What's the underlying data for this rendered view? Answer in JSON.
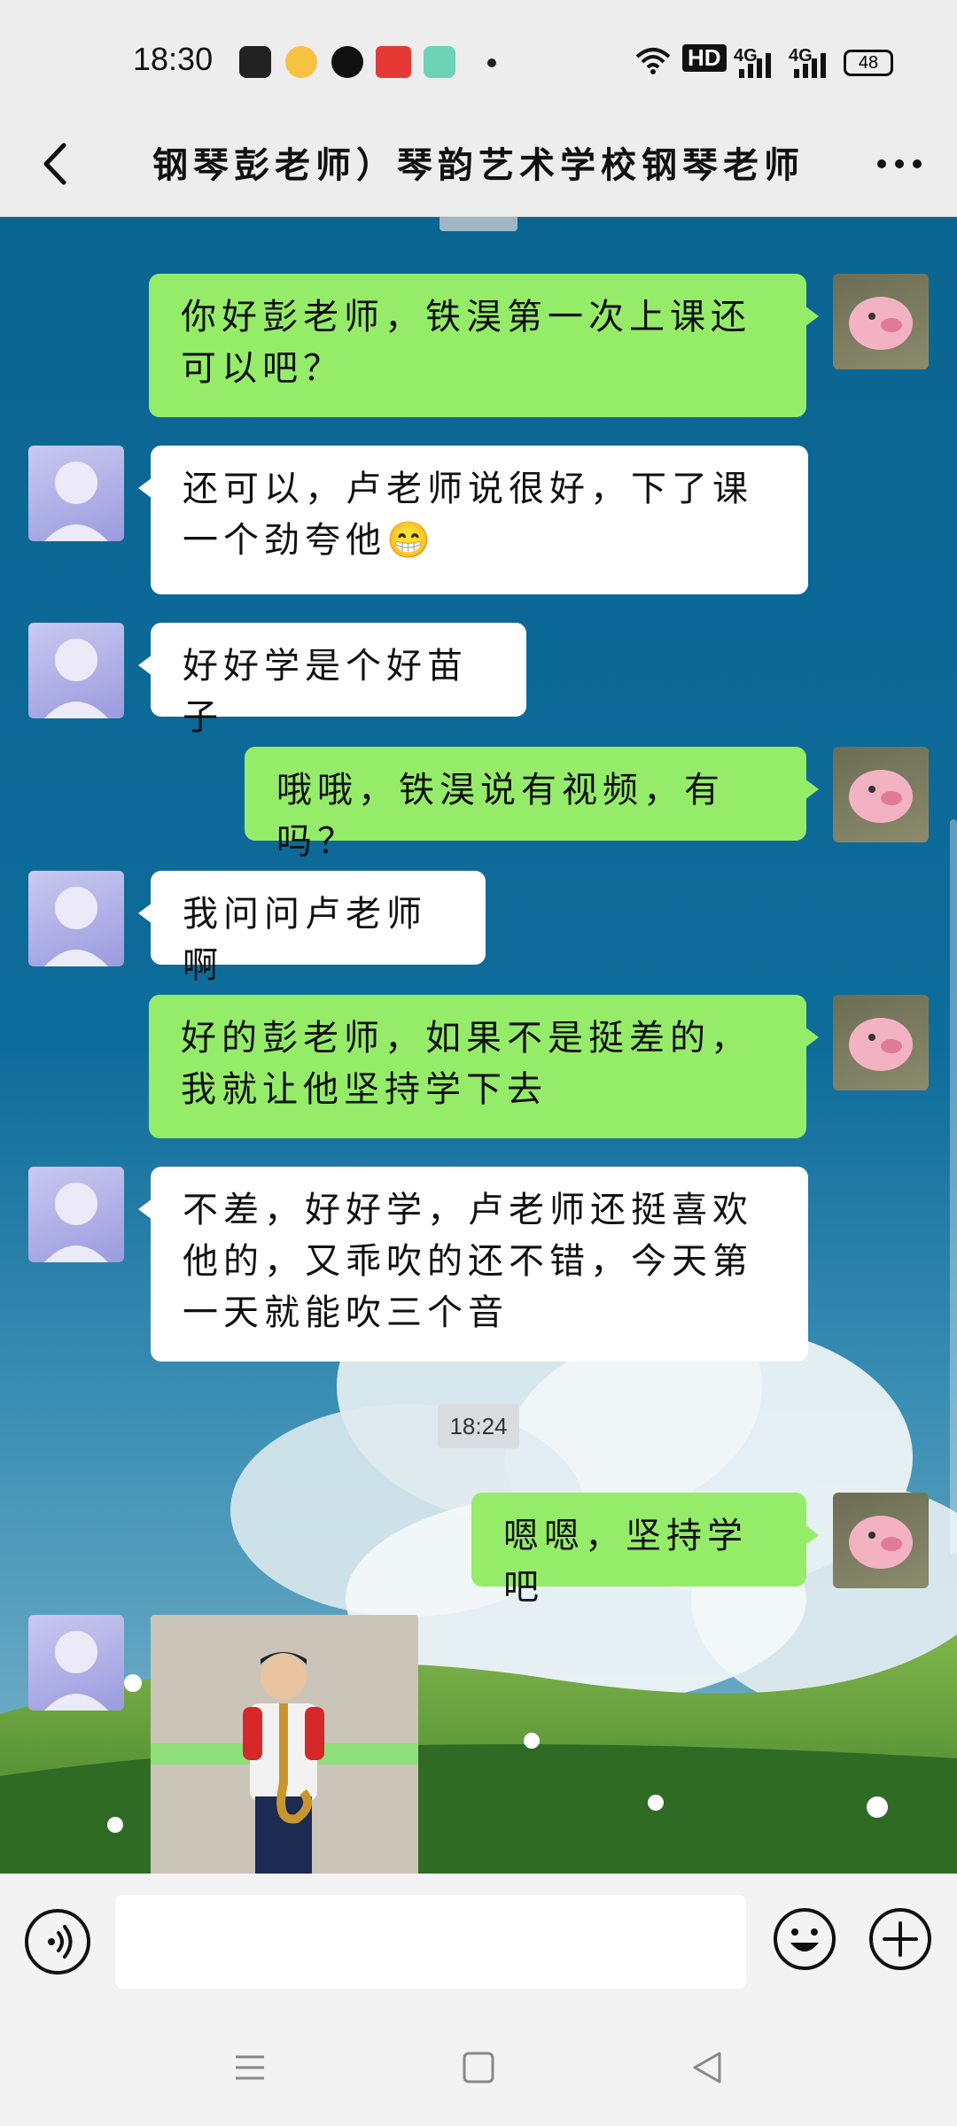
{
  "status_bar": {
    "time": "18:30",
    "signal_1": "4G",
    "signal_2": "4G",
    "hd": "HD",
    "battery": "48",
    "app_icons": [
      "paw-icon",
      "weibo-icon",
      "q-icon",
      "toutiao-icon",
      "green-app-icon"
    ]
  },
  "header": {
    "title": "钢琴彭老师）琴韵艺术学校钢琴老师",
    "back_icon": "chevron-left-icon",
    "more_icon": "more-dots-icon"
  },
  "messages": [
    {
      "side": "right",
      "text": "你好彭老师，铁淏第一次上课还可以吧？"
    },
    {
      "side": "left",
      "text": "还可以，卢老师说很好，下了课一个劲夸他😁"
    },
    {
      "side": "left",
      "text": "好好学是个好苗子"
    },
    {
      "side": "right",
      "text": "哦哦，铁淏说有视频，有吗？"
    },
    {
      "side": "left",
      "text": "我问问卢老师啊"
    },
    {
      "side": "right",
      "text": "好的彭老师，如果不是挺差的，我就让他坚持学下去"
    },
    {
      "side": "left",
      "text": "不差，好好学，卢老师还挺喜欢他的，又乖吹的还不错，今天第一天就能吹三个音"
    },
    {
      "side": "right",
      "text": "嗯嗯，坚持学吧"
    }
  ],
  "timestamp": "18:24",
  "photo": {
    "description_icon": "photo-icon"
  },
  "input_bar": {
    "placeholder": "",
    "voice_icon": "voice-icon",
    "emoji_icon": "emoji-icon",
    "plus_icon": "plus-icon"
  },
  "nav_bar": {
    "menu_icon": "menu-icon",
    "home_icon": "home-square-icon",
    "back_icon": "back-triangle-icon"
  },
  "colors": {
    "own_bubble": "#95ec69",
    "other_bubble": "#ffffff",
    "chat_bg": "#0e6a98"
  }
}
